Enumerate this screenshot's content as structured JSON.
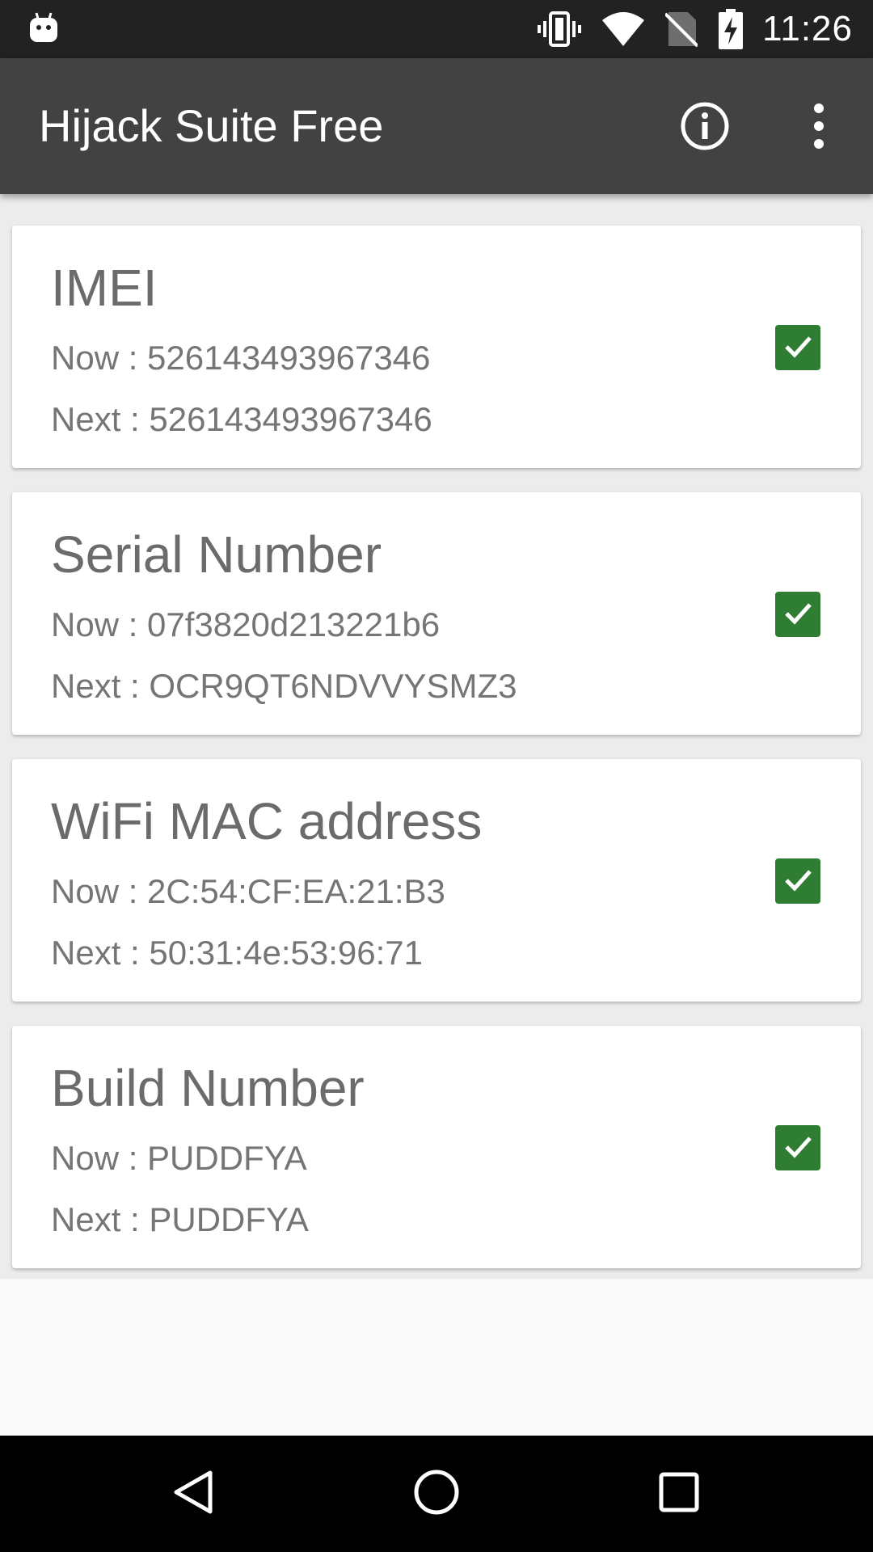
{
  "status_bar": {
    "time": "11:26",
    "icons": [
      "android-robot-icon",
      "vibrate-icon",
      "wifi-icon",
      "no-sim-icon",
      "battery-charging-icon"
    ]
  },
  "app_bar": {
    "title": "Hijack Suite Free",
    "actions": [
      "info-icon",
      "overflow-menu-icon"
    ]
  },
  "cards": [
    {
      "title": "IMEI",
      "now": "Now : 526143493967346",
      "next": "Next : 526143493967346",
      "checked": true
    },
    {
      "title": "Serial Number",
      "now": "Now : 07f3820d213221b6",
      "next": "Next : OCR9QT6NDVVYSMZ3",
      "checked": true
    },
    {
      "title": "WiFi MAC address",
      "now": "Now : 2C:54:CF:EA:21:B3",
      "next": "Next : 50:31:4e:53:96:71",
      "checked": true
    },
    {
      "title": "Build Number",
      "now": "Now : PUDDFYA",
      "next": "Next : PUDDFYA",
      "checked": true
    }
  ],
  "nav_bar": [
    "back-icon",
    "home-icon",
    "recents-icon"
  ],
  "colors": {
    "status_bar": "#222222",
    "app_bar": "#424242",
    "checkbox": "#2e7d32",
    "background": "#fafafa"
  }
}
